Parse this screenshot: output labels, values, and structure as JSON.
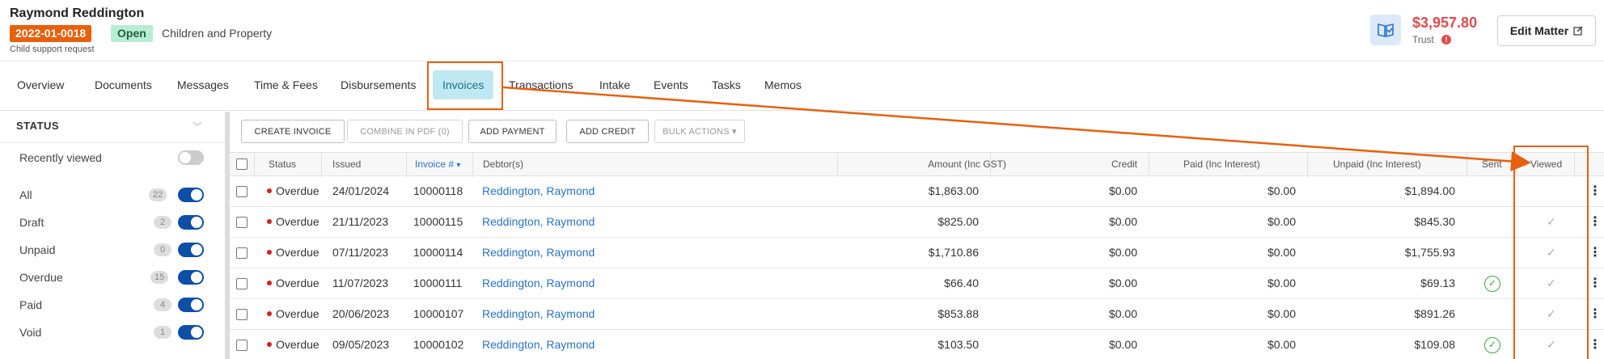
{
  "header": {
    "client_name": "Raymond Reddington",
    "matter_number": "2022-01-0018",
    "status": "Open",
    "matter_type": "Children and Property",
    "matter_description": "Child support request",
    "trust_amount": "$3,957.80",
    "trust_label": "Trust",
    "trust_warning": "!",
    "edit_button": "Edit Matter",
    "trust_icon": "book-check-icon",
    "edit_icon": "edit-icon"
  },
  "tabs": [
    {
      "label": "Overview"
    },
    {
      "label": "Documents"
    },
    {
      "label": "Messages"
    },
    {
      "label": "Time & Fees"
    },
    {
      "label": "Disbursements"
    },
    {
      "label": "Invoices",
      "active": true
    },
    {
      "label": "Transactions"
    },
    {
      "label": "Intake"
    },
    {
      "label": "Events"
    },
    {
      "label": "Tasks"
    },
    {
      "label": "Memos"
    }
  ],
  "sidebar": {
    "title": "STATUS",
    "recently_viewed": "Recently viewed",
    "filters": [
      {
        "label": "All",
        "count": "22"
      },
      {
        "label": "Draft",
        "count": "2"
      },
      {
        "label": "Unpaid",
        "count": "0"
      },
      {
        "label": "Overdue",
        "count": "15"
      },
      {
        "label": "Paid",
        "count": "4"
      },
      {
        "label": "Void",
        "count": "1"
      }
    ]
  },
  "actions": {
    "create_invoice": "CREATE INVOICE",
    "combine_pdf": "COMBINE IN PDF (0)",
    "add_payment": "ADD PAYMENT",
    "add_credit": "ADD CREDIT",
    "bulk_actions": "BULK ACTIONS ▾"
  },
  "table": {
    "headers": {
      "status": "Status",
      "issued": "Issued",
      "invoice": "Invoice #",
      "debtor": "Debtor(s)",
      "amount": "Amount (Inc GST)",
      "credit": "Credit",
      "paid": "Paid (Inc Interest)",
      "unpaid": "Unpaid (Inc Interest)",
      "sent": "Sent",
      "viewed": "Viewed"
    },
    "sort_indicator": "▾",
    "rows": [
      {
        "status": "Overdue",
        "issued": "24/01/2024",
        "invoice": "10000118",
        "debtor": "Reddington, Raymond",
        "amount": "$1,863.00",
        "credit": "$0.00",
        "paid": "$0.00",
        "unpaid": "$1,894.00",
        "sent": false,
        "viewed": false
      },
      {
        "status": "Overdue",
        "issued": "21/11/2023",
        "invoice": "10000115",
        "debtor": "Reddington, Raymond",
        "amount": "$825.00",
        "credit": "$0.00",
        "paid": "$0.00",
        "unpaid": "$845.30",
        "sent": false,
        "viewed": true
      },
      {
        "status": "Overdue",
        "issued": "07/11/2023",
        "invoice": "10000114",
        "debtor": "Reddington, Raymond",
        "amount": "$1,710.86",
        "credit": "$0.00",
        "paid": "$0.00",
        "unpaid": "$1,755.93",
        "sent": false,
        "viewed": true
      },
      {
        "status": "Overdue",
        "issued": "11/07/2023",
        "invoice": "10000111",
        "debtor": "Reddington, Raymond",
        "amount": "$66.40",
        "credit": "$0.00",
        "paid": "$0.00",
        "unpaid": "$69.13",
        "sent": true,
        "viewed": true
      },
      {
        "status": "Overdue",
        "issued": "20/06/2023",
        "invoice": "10000107",
        "debtor": "Reddington, Raymond",
        "amount": "$853.88",
        "credit": "$0.00",
        "paid": "$0.00",
        "unpaid": "$891.26",
        "sent": false,
        "viewed": true
      },
      {
        "status": "Overdue",
        "issued": "09/05/2023",
        "invoice": "10000102",
        "debtor": "Reddington, Raymond",
        "amount": "$103.50",
        "credit": "$0.00",
        "paid": "$0.00",
        "unpaid": "$109.08",
        "sent": true,
        "viewed": true
      }
    ]
  },
  "colors": {
    "accent_orange": "#e8600c",
    "link_blue": "#2a72c9",
    "toggle_blue": "#0d4ea6",
    "overdue_red": "#d71f1f",
    "sent_green": "#3aa64b"
  }
}
